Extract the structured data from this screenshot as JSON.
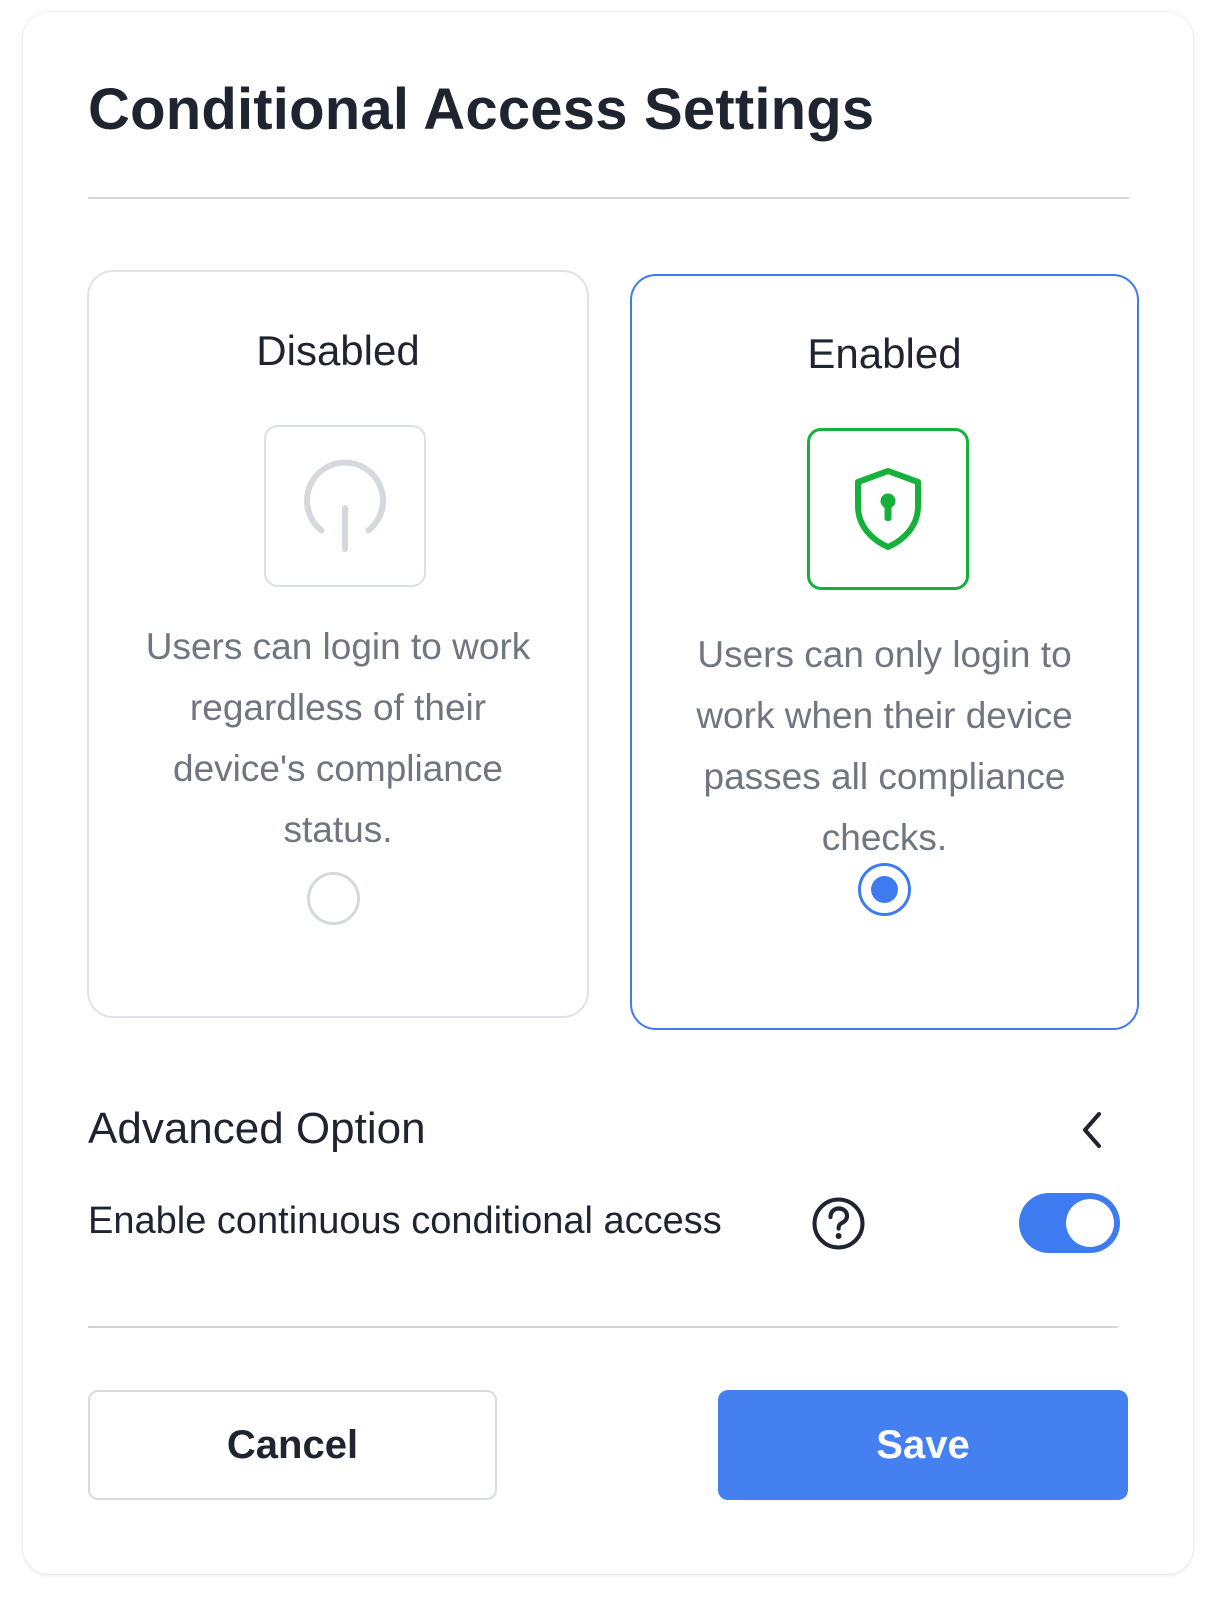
{
  "dialog": {
    "title": "Conditional Access Settings"
  },
  "options": {
    "disabled": {
      "title": "Disabled",
      "description": "Users can login to work regardless of their device's compliance status.",
      "icon": "power-icon",
      "selected": false
    },
    "enabled": {
      "title": "Enabled",
      "description": "Users can only login to work when their device passes all compliance checks.",
      "icon": "shield-lock-icon",
      "selected": true
    }
  },
  "advanced": {
    "title": "Advanced Option",
    "expand_icon": "chevron-left-icon",
    "setting_label": "Enable continuous conditional access",
    "help_icon": "question-circle-icon",
    "toggle_on": true
  },
  "footer": {
    "cancel_label": "Cancel",
    "save_label": "Save"
  },
  "colors": {
    "accent": "#3f7bf0",
    "success": "#16b13b",
    "muted_text": "#6f7680",
    "border": "#dfe2e6"
  }
}
